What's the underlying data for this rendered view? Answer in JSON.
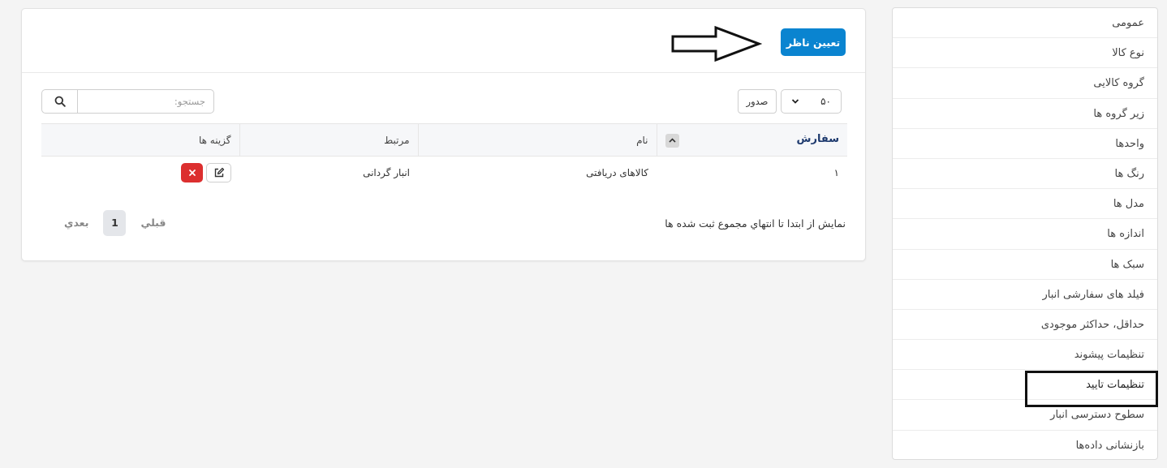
{
  "sidebar": {
    "items": [
      {
        "label": "عمومی"
      },
      {
        "label": "نوع کالا"
      },
      {
        "label": "گروه کالایی"
      },
      {
        "label": "زیر گروه ها"
      },
      {
        "label": "واحدها"
      },
      {
        "label": "رنگ ها"
      },
      {
        "label": "مدل ها"
      },
      {
        "label": "اندازه ها"
      },
      {
        "label": "سبک ها"
      },
      {
        "label": "فیلد های سفارشی انبار"
      },
      {
        "label": "حداقل، حداکثر موجودی"
      },
      {
        "label": "تنظیمات پیشوند"
      },
      {
        "label": "تنظیمات تایید"
      },
      {
        "label": "سطوح دسترسی انبار"
      },
      {
        "label": "بازنشانی داده‌ها"
      }
    ],
    "active_index": 12
  },
  "header": {
    "primary_button": "تعیین ناظر"
  },
  "controls": {
    "page_length": "۵۰",
    "export_label": "صدور",
    "search_placeholder": "جستجو:"
  },
  "table": {
    "columns": [
      "سفارش",
      "نام",
      "مرتبط",
      "گزینه ها"
    ],
    "rows": [
      {
        "order": "۱",
        "name": "کالاهای دریافتی",
        "related": "انبار گردانی"
      }
    ]
  },
  "footer": {
    "info": "نمايش از ابتدا تا انتهاي مجموع ثبت شده ها",
    "prev_label": "قبلي",
    "next_label": "بعدي",
    "current_page": "1"
  },
  "colors": {
    "primary": "#0a84d0",
    "danger": "#dc2f2f",
    "sort_header": "#1e3a6e"
  }
}
